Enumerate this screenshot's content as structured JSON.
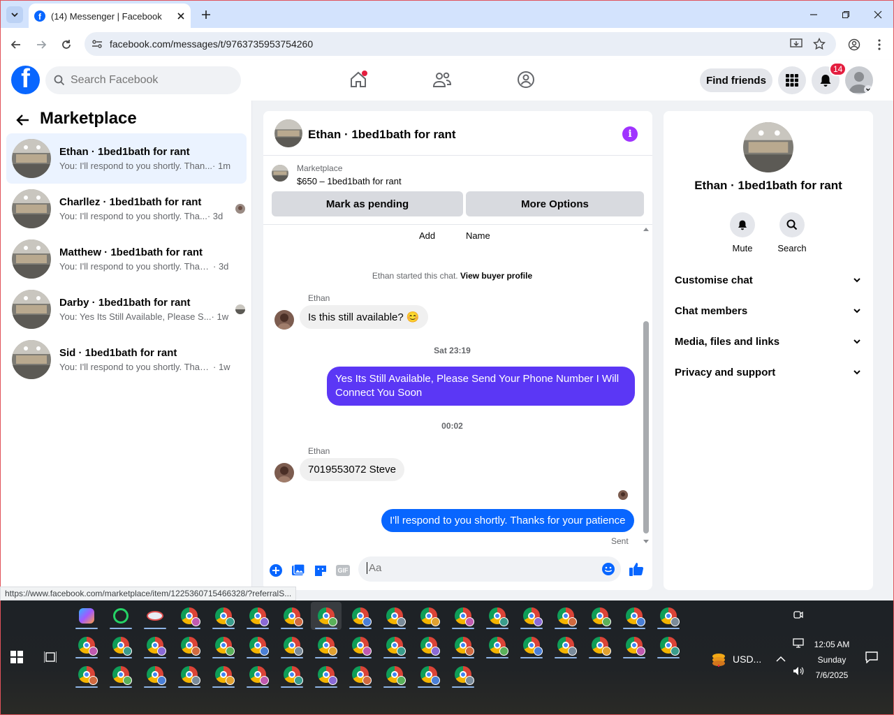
{
  "browser": {
    "tab_title": "(14) Messenger | Facebook",
    "url": "facebook.com/messages/t/9763735953754260",
    "status_url": "https://www.facebook.com/marketplace/item/1225360715466328/?referralS..."
  },
  "fb": {
    "search_placeholder": "Search Facebook",
    "find_friends": "Find friends",
    "notif_count": "14"
  },
  "left": {
    "title": "Marketplace",
    "conversations": [
      {
        "name": "Ethan · 1bed1bath for rant",
        "snippet": "You: I'll respond to you shortly. Than...",
        "time": "· 1m"
      },
      {
        "name": "Charllez · 1bed1bath for rant",
        "snippet": "You: I'll respond to you shortly. Tha...",
        "time": "· 3d"
      },
      {
        "name": "Matthew · 1bed1bath for rant",
        "snippet": "You: I'll respond to you shortly. Thank...",
        "time": "· 3d"
      },
      {
        "name": "Darby · 1bed1bath for rant",
        "snippet": "You: Yes Its Still Available, Please S...",
        "time": "· 1w"
      },
      {
        "name": "Sid · 1bed1bath for rant",
        "snippet": "You: I'll respond to you shortly. Thank...",
        "time": "· 1w"
      }
    ]
  },
  "chat": {
    "header_name": "Ethan · 1bed1bath for rant",
    "mp_label": "Marketplace",
    "mp_price": "$650 – 1bed1bath for rant",
    "mark_pending": "Mark as pending",
    "more_options": "More Options",
    "partial_add": "Add",
    "partial_name": "Name",
    "started_text": "Ethan started this chat.",
    "view_profile": "View buyer profile",
    "sender": "Ethan",
    "msg1": "Is this still available? 😊",
    "ts1": "Sat 23:19",
    "msg2": "Yes Its Still Available, Please Send Your Phone Number I Will Connect You Soon",
    "ts2": "00:02",
    "msg3": "7019553072 Steve",
    "msg4": "I'll respond to you shortly. Thanks for your patience",
    "sent": "Sent",
    "input_placeholder": "Aa",
    "gif": "GIF"
  },
  "right": {
    "name": "Ethan · 1bed1bath for rant",
    "mute": "Mute",
    "search": "Search",
    "rows": [
      "Customise chat",
      "Chat members",
      "Media, files and links",
      "Privacy and support"
    ]
  },
  "taskbar": {
    "time": "12:05 AM",
    "day": "Sunday",
    "date": "7/6/2025",
    "usd": "USD..."
  },
  "colors": {
    "fb_blue": "#0866ff",
    "outgoing_purple": "#5b37f5",
    "info_purple": "#a033ff",
    "badge_red": "#e41e3f"
  }
}
